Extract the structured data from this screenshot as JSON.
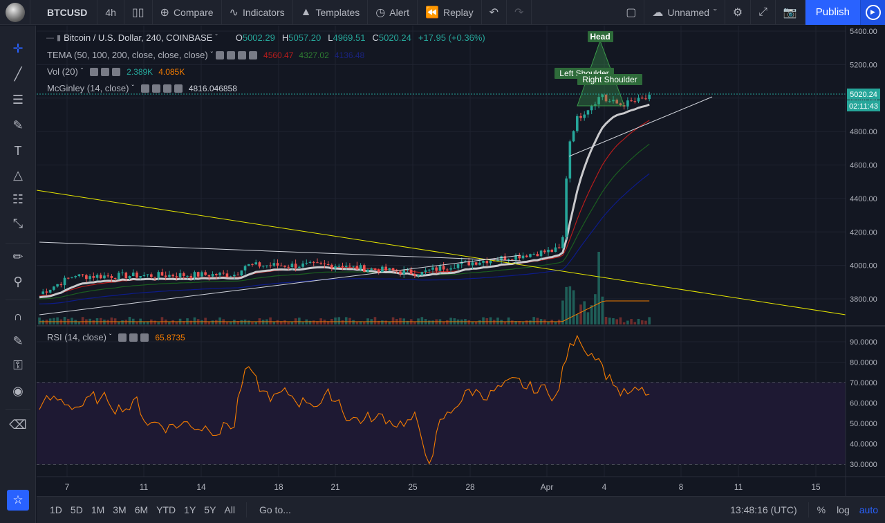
{
  "toolbar": {
    "symbol": "BTCUSD",
    "interval": "4h",
    "compare": "Compare",
    "indicators": "Indicators",
    "templates": "Templates",
    "alert": "Alert",
    "replay": "Replay",
    "layout_name": "Unnamed",
    "publish": "Publish"
  },
  "legend": {
    "title": "Bitcoin / U.S. Dollar, 240, COINBASE",
    "ohlc": {
      "o_label": "O",
      "o": "5002.29",
      "h_label": "H",
      "h": "5057.20",
      "l_label": "L",
      "l": "4969.51",
      "c_label": "C",
      "c": "5020.24",
      "change": "+17.95 (+0.36%)"
    },
    "tema": {
      "label": "TEMA (50, 100, 200, close, close, close)",
      "v1": "4560.47",
      "v2": "4327.02",
      "v3": "4136.48"
    },
    "vol": {
      "label": "Vol (20)",
      "v1": "2.389K",
      "v2": "4.085K"
    },
    "mcginley": {
      "label": "McGinley (14, close)",
      "v1": "4816.046858"
    },
    "rsi": {
      "label": "RSI (14, close)",
      "v1": "65.8735"
    }
  },
  "annotations": {
    "head": "Head",
    "left_shoulder": "Left Shoulder",
    "right_shoulder": "Right Shoulder"
  },
  "price_axis": {
    "ticks": [
      "5400.00",
      "5200.00",
      "5000.00",
      "4800.00",
      "4600.00",
      "4400.00",
      "4200.00",
      "4000.00",
      "3800.00"
    ],
    "last_price": "5020.24",
    "countdown": "02:11:43"
  },
  "rsi_axis": {
    "ticks": [
      "90.0000",
      "80.0000",
      "70.0000",
      "60.0000",
      "50.0000",
      "40.0000",
      "30.0000"
    ]
  },
  "time_axis": {
    "ticks": [
      "7",
      "11",
      "14",
      "18",
      "21",
      "25",
      "28",
      "Apr",
      "4",
      "8",
      "11",
      "15"
    ]
  },
  "bottom": {
    "ranges": [
      "1D",
      "5D",
      "1M",
      "3M",
      "6M",
      "YTD",
      "1Y",
      "5Y",
      "All"
    ],
    "goto": "Go to...",
    "clock": "13:48:16 (UTC)",
    "pct": "%",
    "log": "log",
    "auto": "auto"
  },
  "colors": {
    "bg": "#131722",
    "up": "#26a69a",
    "down": "#ef5350",
    "tema1": "#b71c1c",
    "tema2": "#1b5e20",
    "tema3": "#0d1b8a",
    "mcginley": "#c9c9cc",
    "rsi": "#f57c00",
    "trend_yellow": "#e6e600",
    "accent": "#2962ff"
  }
}
